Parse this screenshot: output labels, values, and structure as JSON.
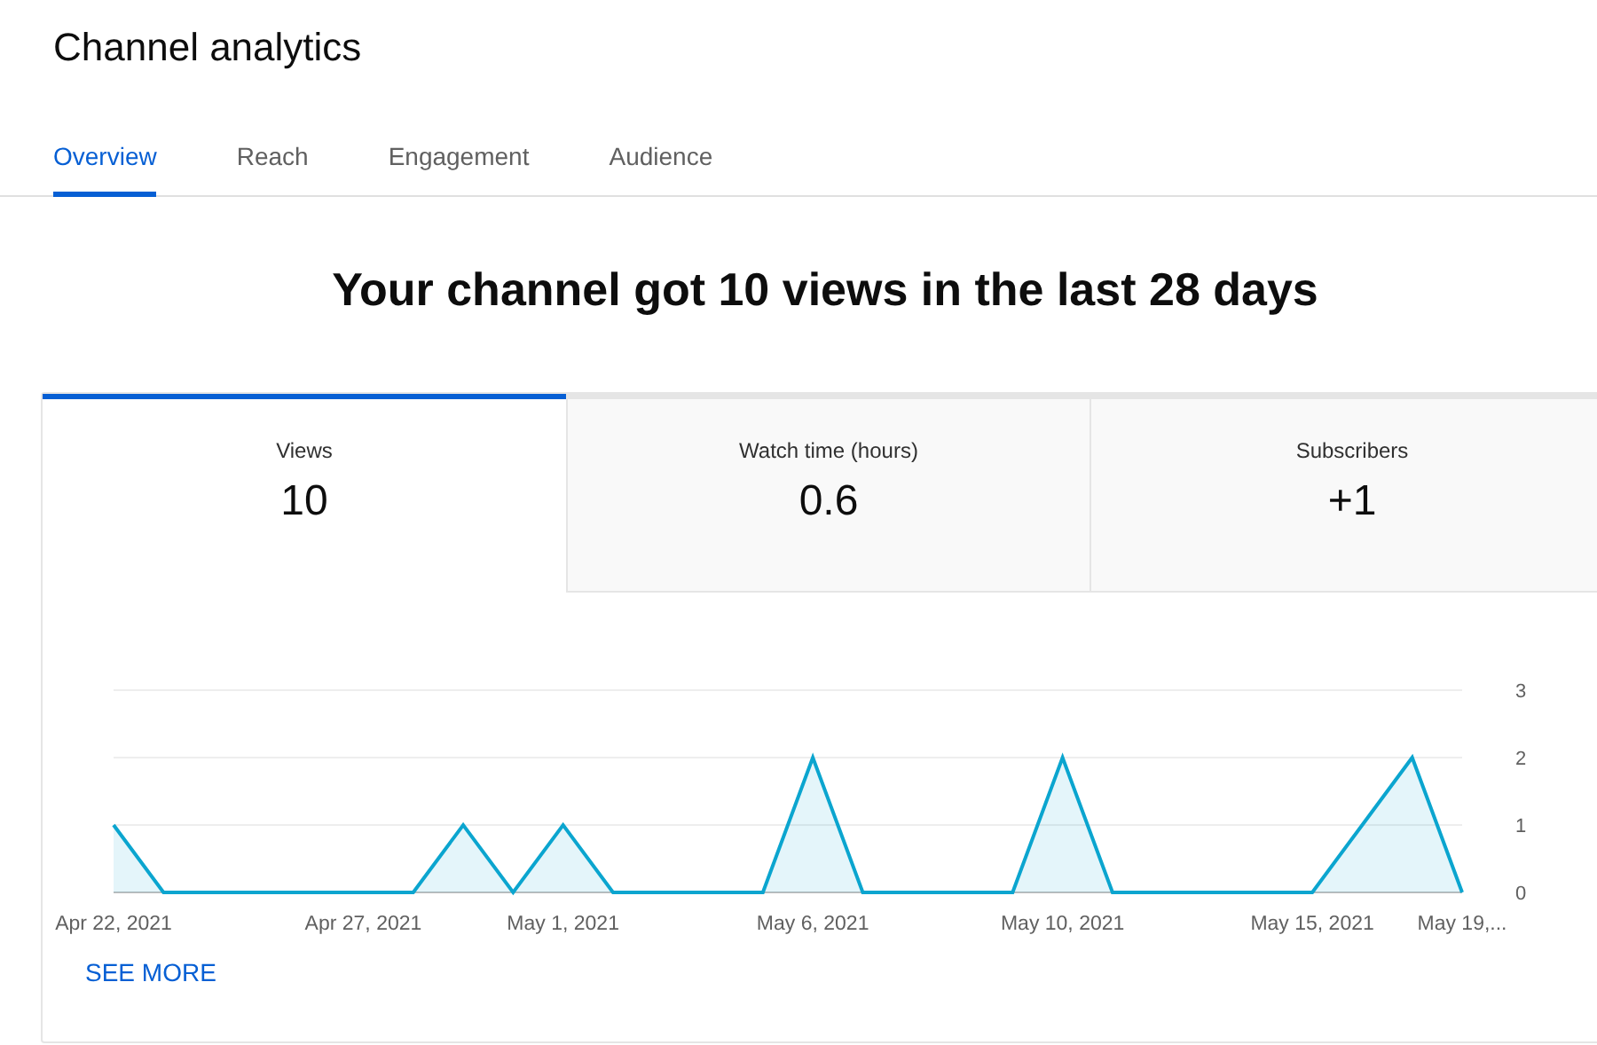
{
  "page_title": "Channel analytics",
  "tabs": [
    {
      "label": "Overview",
      "selected": true
    },
    {
      "label": "Reach",
      "selected": false
    },
    {
      "label": "Engagement",
      "selected": false
    },
    {
      "label": "Audience",
      "selected": false
    }
  ],
  "headline": "Your channel got 10 views in the last 28 days",
  "metrics": [
    {
      "label": "Views",
      "value": "10",
      "selected": true
    },
    {
      "label": "Watch time (hours)",
      "value": "0.6",
      "selected": false
    },
    {
      "label": "Subscribers",
      "value": "+1",
      "selected": false
    }
  ],
  "chart_data": {
    "type": "area",
    "categories": [
      "Apr 22, 2021",
      null,
      null,
      null,
      null,
      "Apr 27, 2021",
      null,
      null,
      null,
      "May 1, 2021",
      null,
      null,
      null,
      null,
      "May 6, 2021",
      null,
      null,
      null,
      null,
      "May 10, 2021",
      null,
      null,
      null,
      null,
      "May 15, 2021",
      null,
      null,
      "May 19,..."
    ],
    "series": [
      {
        "color": "#0ba5cf",
        "values": [
          1,
          0,
          0,
          0,
          0,
          0,
          0,
          1,
          0,
          1,
          0,
          0,
          0,
          0,
          2,
          0,
          0,
          0,
          0,
          2,
          0,
          0,
          0,
          0,
          0,
          1,
          2,
          0
        ]
      }
    ],
    "ylim": [
      0,
      3
    ],
    "yticks": [
      0,
      1,
      2,
      3
    ]
  },
  "see_more": "SEE MORE"
}
